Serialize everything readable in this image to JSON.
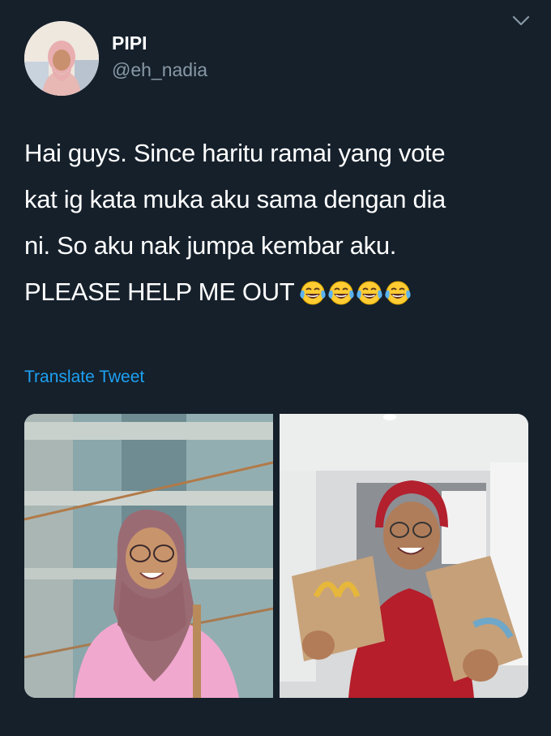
{
  "tweet": {
    "display_name": "PIPI",
    "handle": "@eh_nadia",
    "text_lines": [
      "Hai guys. Since haritu ramai yang vote",
      "kat ig kata muka aku sama dengan dia",
      "ni. So aku nak jumpa kembar aku.",
      "PLEASE HELP ME OUT"
    ],
    "emojis": [
      "face-with-tears-of-joy",
      "face-with-tears-of-joy",
      "face-with-tears-of-joy",
      "face-with-tears-of-joy"
    ],
    "translate_label": "Translate Tweet",
    "media": [
      {
        "name": "photo-woman-hijab"
      },
      {
        "name": "photo-delivery-rider"
      }
    ]
  },
  "colors": {
    "background": "#15202b",
    "text": "#ffffff",
    "secondary_text": "#8899a6",
    "link": "#1da1f2"
  },
  "icons": {
    "menu": "chevron-down-icon",
    "emoji": "face-with-tears-of-joy-icon"
  }
}
